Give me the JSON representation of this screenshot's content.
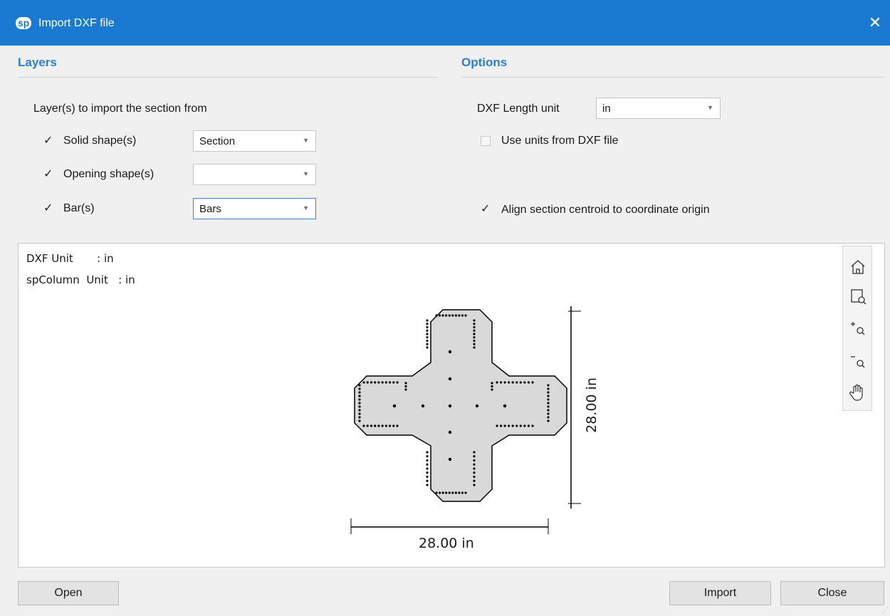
{
  "window": {
    "logo": "sp",
    "title": "Import DXF file",
    "close_glyph": "✕"
  },
  "layers": {
    "heading": "Layers",
    "prompt": "Layer(s) to import the section from",
    "rows": [
      {
        "label": "Solid shape(s)",
        "checked": true,
        "value": "Section"
      },
      {
        "label": "Opening shape(s)",
        "checked": true,
        "value": ""
      },
      {
        "label": "Bar(s)",
        "checked": true,
        "value": "Bars"
      }
    ]
  },
  "options": {
    "heading": "Options",
    "length_unit_label": "DXF Length unit",
    "length_unit_value": "in",
    "use_units_label": "Use units from DXF file",
    "use_units_checked": false,
    "align_label": "Align section centroid to coordinate origin",
    "align_checked": true
  },
  "preview": {
    "dxf_unit": "DXF Unit       : in",
    "sp_unit": "spColumn  Unit   : in",
    "dim_horizontal": "28.00 in",
    "dim_vertical": "28.00 in"
  },
  "toolbar_icons": [
    "home-icon",
    "zoom-window-icon",
    "zoom-in-icon",
    "zoom-out-icon",
    "pan-hand-icon"
  ],
  "buttons": {
    "open": "Open",
    "import": "Import",
    "close": "Close"
  },
  "colors": {
    "titlebar": "#1a7ad1",
    "heading": "#2b7fd2",
    "section_fill": "#d9d9d9"
  }
}
